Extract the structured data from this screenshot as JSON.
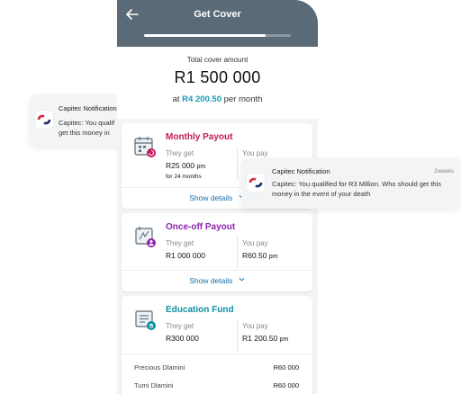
{
  "header": {
    "title": "Get Cover",
    "progress_fraction": 0.83
  },
  "summary": {
    "label": "Total cover amount",
    "amount": "R1 500 000",
    "monthly_prefix": "at",
    "monthly_amount": "R4 200.50",
    "monthly_suffix": "per month"
  },
  "cards": [
    {
      "title": "Monthly Payout",
      "title_color": "#c2185b",
      "they_get_label": "They get",
      "they_get_value": "R25 000",
      "they_get_unit": "pm",
      "they_get_sub": "for 24 months",
      "you_pay_label": "You pay",
      "show_details": "Show details",
      "icon": "calendar-icon"
    },
    {
      "title": "Once-off Payout",
      "title_color": "#8e24aa",
      "they_get_label": "They get",
      "they_get_value": "R1 000 000",
      "you_pay_label": "You pay",
      "you_pay_value": "R60.50",
      "you_pay_unit": "pm",
      "show_details": "Show details",
      "icon": "document-person-icon"
    },
    {
      "title": "Education Fund",
      "title_color": "#0f8fa3",
      "they_get_label": "They get",
      "they_get_value": "R300 000",
      "you_pay_label": "You pay",
      "you_pay_value": "R1 200.50",
      "you_pay_unit": "pm",
      "icon": "education-icon",
      "beneficiaries": [
        {
          "name": "Precious Dlamini",
          "amount": "R60 000"
        },
        {
          "name": "Tumi Dlamini",
          "amount": "R60 000"
        }
      ]
    }
  ],
  "notification_left": {
    "app": "Capitec Notification",
    "body_line1": "Capitec: You qualif",
    "body_line2": "get this money in"
  },
  "notification_right": {
    "app": "Capitec Notification",
    "time": "2weeks",
    "body": "Capitec: You qualified for R3 Million. Who should get this money in the event of your death"
  },
  "colors": {
    "header_bg": "#5a6b77",
    "accent_blue": "#1a9bb5",
    "link_blue": "#1a6fa8",
    "capitec_red": "#d7263d",
    "capitec_navy": "#1c2e6b"
  }
}
